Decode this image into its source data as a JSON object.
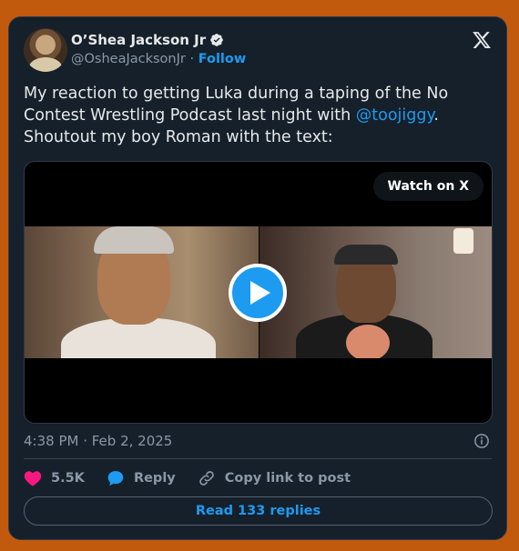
{
  "tweet": {
    "author_name": "O’Shea Jackson Jr",
    "handle": "@OsheaJacksonJr",
    "separator": "·",
    "follow_label": "Follow",
    "text_before": "My reaction to getting Luka during a taping of the No Contest Wrestling Podcast last night with ",
    "mention": "@toojiggy",
    "text_after": ". Shoutout my boy Roman with the text:",
    "watch_label": "Watch on X",
    "timestamp": "4:38 PM · Feb 2, 2025",
    "likes": "5.5K",
    "reply_label": "Reply",
    "copy_label": "Copy link to post",
    "read_replies": "Read 133 replies"
  },
  "colors": {
    "background": "#c25a0e",
    "card": "#15202b",
    "accent": "#1d9bf0",
    "like": "#f91880"
  },
  "icons": [
    "verified-icon",
    "x-logo-icon",
    "play-icon",
    "info-icon",
    "heart-icon",
    "reply-icon",
    "link-icon"
  ]
}
